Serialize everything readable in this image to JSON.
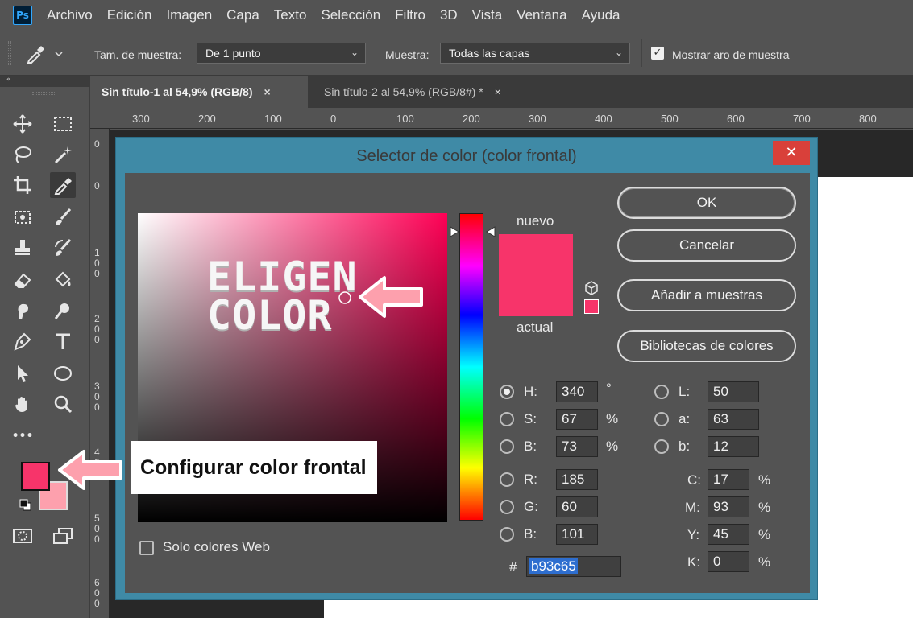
{
  "app": {
    "logo": "Ps"
  },
  "menu": [
    "Archivo",
    "Edición",
    "Imagen",
    "Capa",
    "Texto",
    "Selección",
    "Filtro",
    "3D",
    "Vista",
    "Ventana",
    "Ayuda"
  ],
  "options": {
    "sample_size_label": "Tam. de muestra:",
    "sample_size_value": "De 1 punto",
    "sample_label": "Muestra:",
    "sample_value": "Todas las capas",
    "show_ring_label": "Mostrar aro de muestra",
    "show_ring_checked": true
  },
  "tabs": [
    {
      "label": "Sin título-1 al 54,9% (RGB/8)",
      "close": "×"
    },
    {
      "label": "Sin título-2 al 54,9% (RGB/8#) *",
      "close": "×"
    }
  ],
  "ruler": {
    "top": [
      "300",
      "200",
      "100",
      "0",
      "100",
      "200",
      "300",
      "400",
      "500",
      "600",
      "700",
      "800"
    ],
    "left": [
      "0",
      "0",
      "1 0 0",
      "2 0 0",
      "3 0 0",
      "4 0 0",
      "5 0 0",
      "6 0 0"
    ]
  },
  "toolbar": {
    "collapse": "«",
    "more": "•••"
  },
  "dialog": {
    "title": "Selector de color (color frontal)",
    "close": "✕",
    "new_label": "nuevo",
    "current_label": "actual",
    "new_color": "#f7346a",
    "current_color": "#f7346a",
    "buttons": {
      "ok": "OK",
      "cancel": "Cancelar",
      "add": "Añadir a muestras",
      "libraries": "Bibliotecas de colores"
    },
    "hsb": [
      {
        "label": "H:",
        "value": "340",
        "unit": "°",
        "selected": true
      },
      {
        "label": "S:",
        "value": "67",
        "unit": "%",
        "selected": false
      },
      {
        "label": "B:",
        "value": "73",
        "unit": "%",
        "selected": false
      }
    ],
    "rgb": [
      {
        "label": "R:",
        "value": "185"
      },
      {
        "label": "G:",
        "value": "60"
      },
      {
        "label": "B:",
        "value": "101"
      }
    ],
    "lab": [
      {
        "label": "L:",
        "value": "50"
      },
      {
        "label": "a:",
        "value": "63"
      },
      {
        "label": "b:",
        "value": "12"
      }
    ],
    "cmyk": [
      {
        "label": "C:",
        "value": "17",
        "unit": "%"
      },
      {
        "label": "M:",
        "value": "93",
        "unit": "%"
      },
      {
        "label": "Y:",
        "value": "45",
        "unit": "%"
      },
      {
        "label": "K:",
        "value": "0",
        "unit": "%"
      }
    ],
    "hex_label": "#",
    "hex_value": "b93c65",
    "web_only_label": "Solo colores Web"
  },
  "overlay": {
    "eligen_line1": "ELIGEN",
    "eligen_line2": "COLOR",
    "callout": "Configurar color frontal"
  },
  "colors": {
    "foreground": "#f7346a",
    "background": "#fda0ad",
    "arrow": "#fda0ad",
    "dialog_frame": "#3f8aa6"
  }
}
